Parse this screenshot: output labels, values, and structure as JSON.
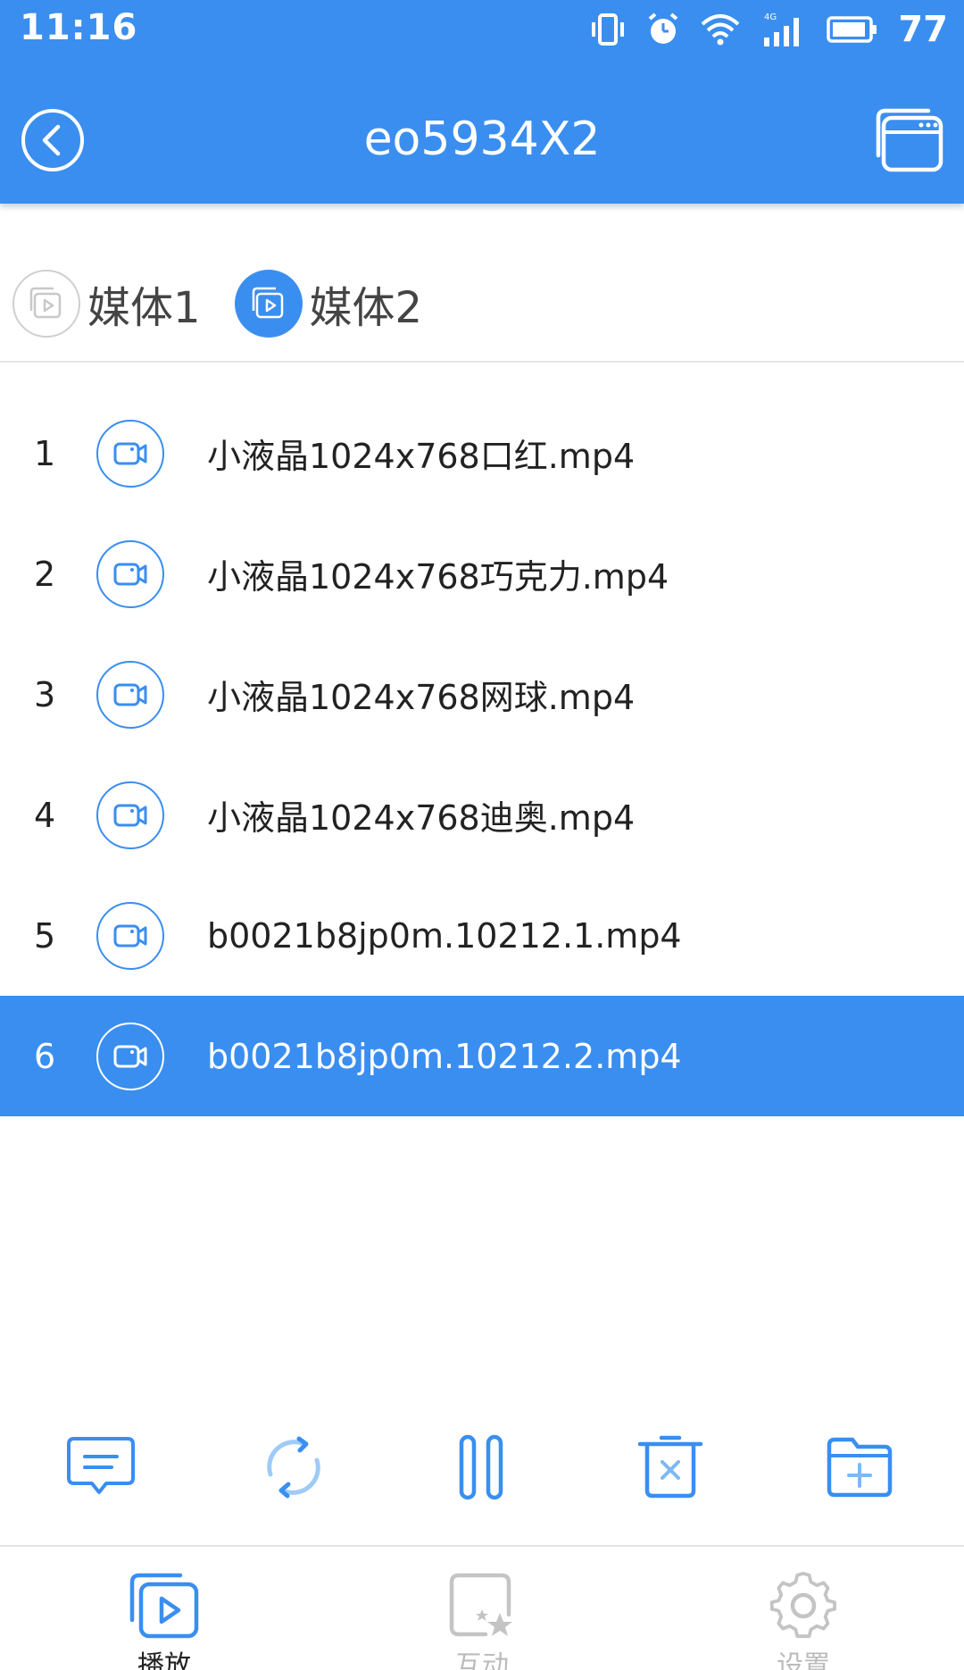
{
  "status_bar": {
    "time": "11:16",
    "network": "4G",
    "battery": "77"
  },
  "app_bar": {
    "title": "eo5934X2",
    "back_icon": "back-circle-icon",
    "window_icon": "window-icon"
  },
  "media_tabs": [
    {
      "label": "媒体1",
      "active": false
    },
    {
      "label": "媒体2",
      "active": true
    }
  ],
  "files": [
    {
      "index": "1",
      "name": "小液晶1024x768口红.mp4",
      "selected": false
    },
    {
      "index": "2",
      "name": "小液晶1024x768巧克力.mp4",
      "selected": false
    },
    {
      "index": "3",
      "name": "小液晶1024x768网球.mp4",
      "selected": false
    },
    {
      "index": "4",
      "name": "小液晶1024x768迪奥.mp4",
      "selected": false
    },
    {
      "index": "5",
      "name": "b0021b8jp0m.10212.1.mp4",
      "selected": false
    },
    {
      "index": "6",
      "name": "b0021b8jp0m.10212.2.mp4",
      "selected": true
    }
  ],
  "toolbar": [
    {
      "icon": "message-icon"
    },
    {
      "icon": "loop-icon"
    },
    {
      "icon": "pause-icon"
    },
    {
      "icon": "delete-icon"
    },
    {
      "icon": "add-folder-icon"
    }
  ],
  "bottom_nav": [
    {
      "label": "播放",
      "active": true,
      "icon": "play-icon"
    },
    {
      "label": "互动",
      "active": false,
      "icon": "interact-icon"
    },
    {
      "label": "设置",
      "active": false,
      "icon": "settings-icon"
    }
  ],
  "colors": {
    "primary": "#3a8ef0",
    "inactive": "#bbbbbb"
  }
}
